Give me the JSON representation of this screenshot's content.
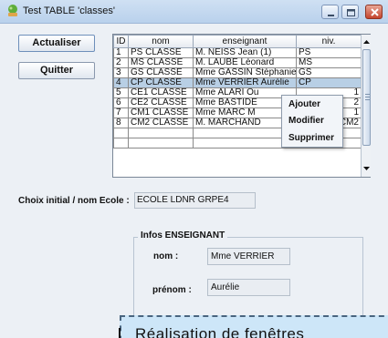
{
  "window": {
    "title": "Test TABLE 'classes'",
    "controls": [
      "minimize-icon",
      "maximize-icon",
      "close-icon"
    ]
  },
  "buttons": {
    "actualiser": "Actualiser",
    "quitter": "Quitter"
  },
  "table": {
    "columns": [
      "ID",
      "nom",
      "enseignant",
      "niv."
    ],
    "rows": [
      [
        "1",
        "PS CLASSE",
        "M. NEISS Jean (1)",
        "PS"
      ],
      [
        "2",
        "MS CLASSE",
        "M. LAUBE Léonard",
        "MS"
      ],
      [
        "3",
        "GS CLASSE",
        "Mme GASSIN Stéphanie",
        "GS"
      ],
      [
        "4",
        "CP CLASSE",
        "Mme VERRIER Aurélie",
        "CP"
      ],
      [
        "5",
        "CE1 CLASSE",
        "Mme ALARI Ou",
        "1"
      ],
      [
        "6",
        "CE2 CLASSE",
        "Mme BASTIDE",
        "2"
      ],
      [
        "7",
        "CM1 CLASSE",
        "Mme MARC M",
        "1"
      ],
      [
        "8",
        "CM2 CLASSE",
        "M. MARCHAND",
        "CM2"
      ]
    ],
    "selected_row_index": 3,
    "colors": {
      "selection": "#b8cfe5"
    }
  },
  "context_menu": {
    "items": [
      "Ajouter",
      "Modifier",
      "Supprimer"
    ]
  },
  "choix": {
    "label": "Choix initial / nom Ecole :",
    "value": "ECOLE LDNR GRPE4"
  },
  "enseignant": {
    "group_title": "Infos ENSEIGNANT",
    "nom_label": "nom :",
    "nom_value": "Mme VERRIER",
    "prenom_label": "prénom :",
    "prenom_value": "Aurélie"
  },
  "caption": {
    "text": "Réalisation de fenêtres"
  }
}
